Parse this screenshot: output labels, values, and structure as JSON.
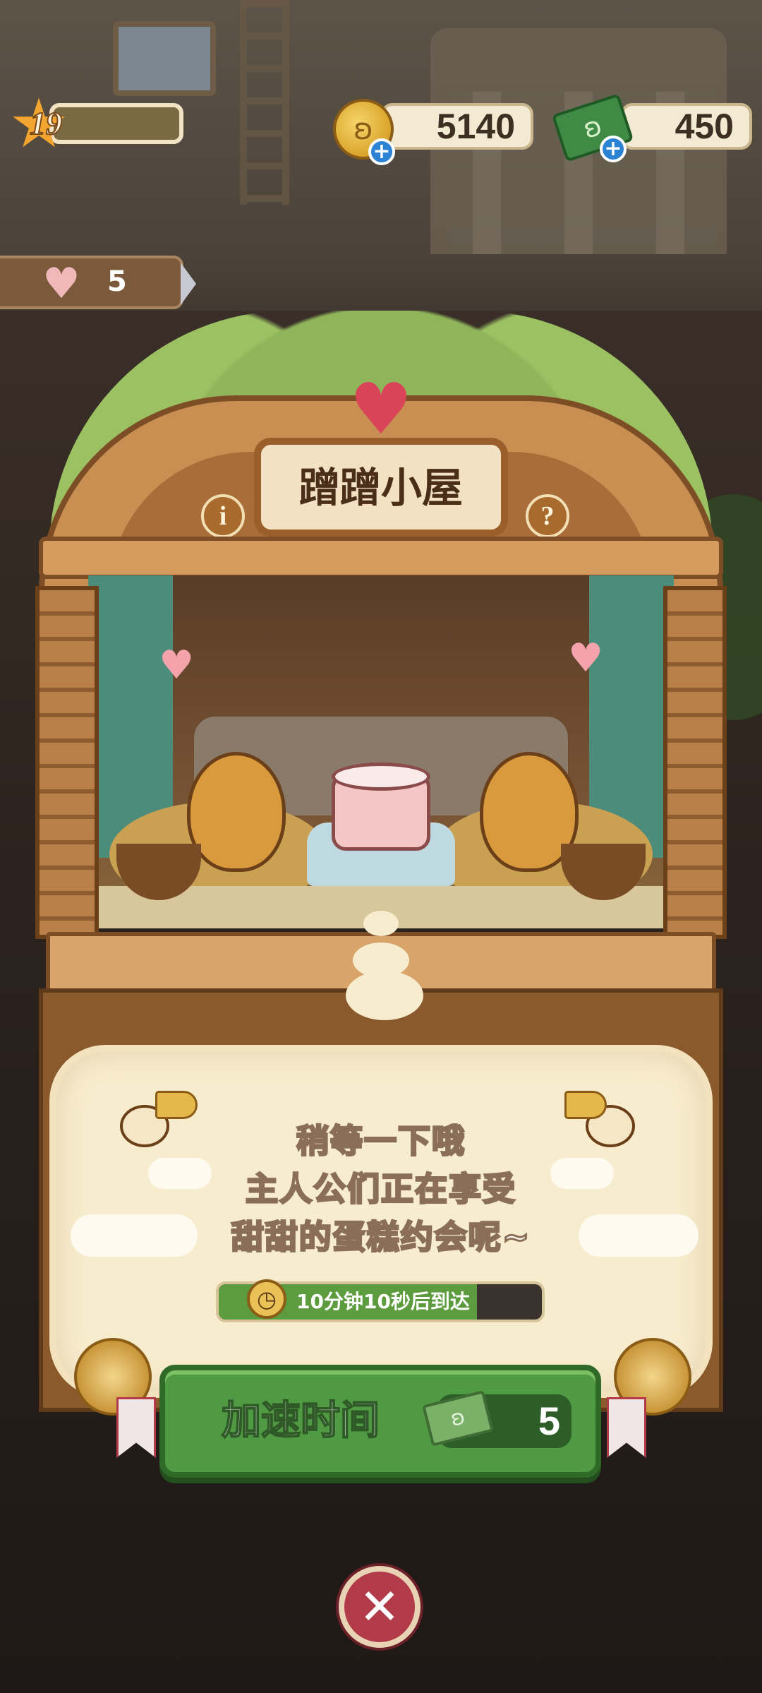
{
  "hud": {
    "level": "19",
    "level_progress": 0.0,
    "coins": "5140",
    "cash": "450",
    "cake_count": "5"
  },
  "cabin": {
    "title": "蹭蹭小屋",
    "info_icon": "i",
    "help_icon": "?"
  },
  "message": {
    "line1": "稍等一下哦",
    "line2": "主人公们正在享受",
    "line3": "甜甜的蛋糕约会呢~"
  },
  "timer": {
    "text": "10分钟10秒后到达",
    "progress": 0.8
  },
  "speed_up": {
    "label": "加速时间",
    "cost": "5"
  },
  "icons": {
    "level": "star-icon",
    "coin": "bunny-coin-icon",
    "cash": "bunny-cash-icon",
    "cake": "heart-cake-icon",
    "close": "close-icon",
    "clock": "clock-icon"
  },
  "colors": {
    "speed_button": "#4f9a43",
    "close_button": "#b23b4a",
    "sign_heart": "#d94458",
    "plus_badge": "#2d83d3"
  }
}
